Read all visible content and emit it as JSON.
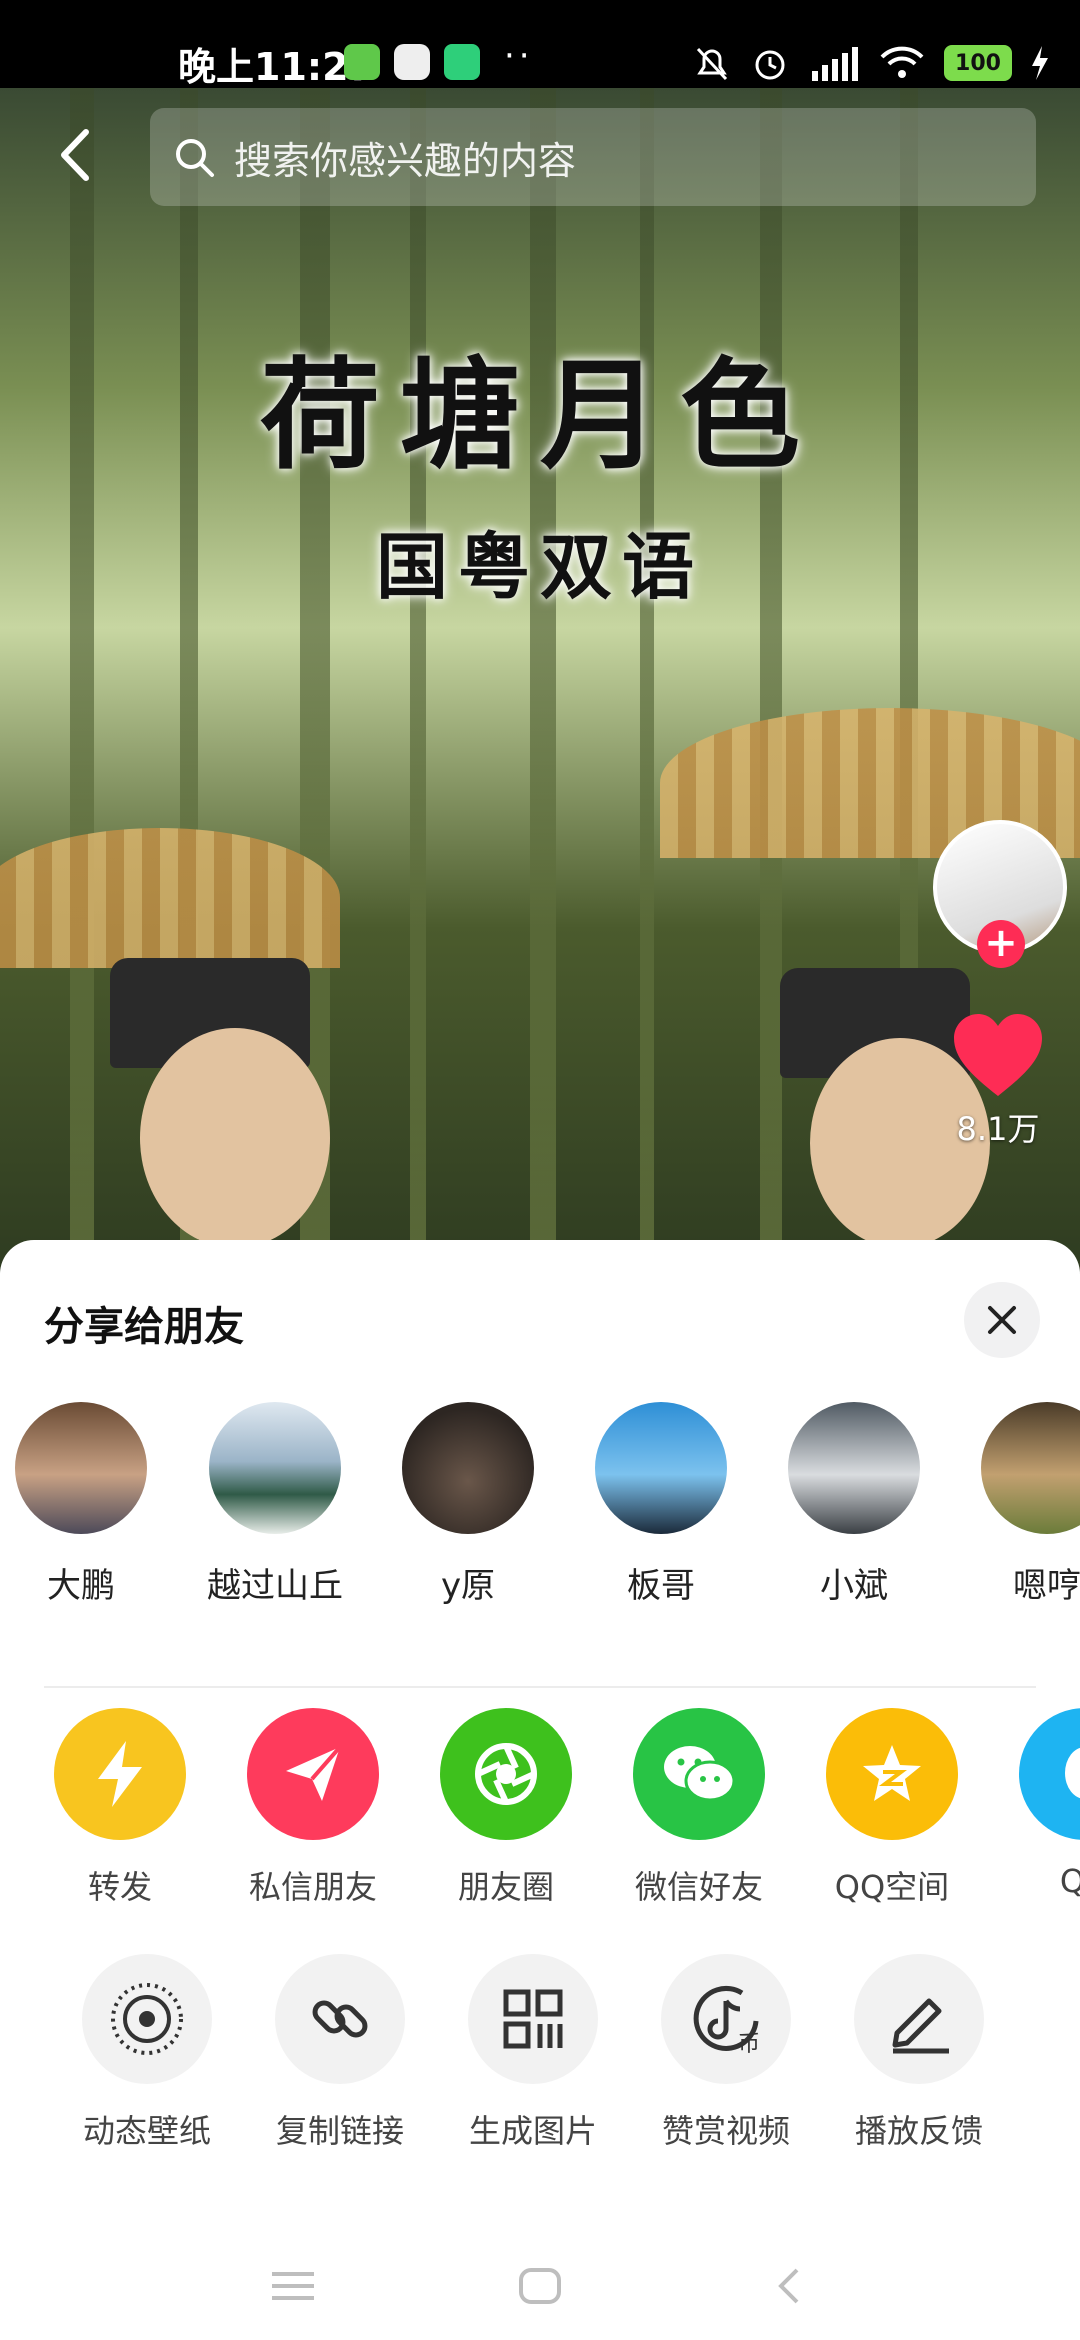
{
  "status_bar": {
    "time": "晚上11:27",
    "dots": "··",
    "battery": "100"
  },
  "search": {
    "placeholder": "搜索你感兴趣的内容"
  },
  "video": {
    "title": "荷塘月色",
    "subtitle": "国粤双语",
    "like_count": "8.1万"
  },
  "share_sheet": {
    "title": "分享给朋友",
    "friends": [
      {
        "name": "大鹏"
      },
      {
        "name": "越过山丘"
      },
      {
        "name": "y原"
      },
      {
        "name": "板哥"
      },
      {
        "name": "小斌"
      },
      {
        "name": "嗯哼"
      }
    ],
    "share_targets": [
      {
        "label": "转发",
        "color": "#f8c51f",
        "icon": "lightning-icon"
      },
      {
        "label": "私信朋友",
        "color": "#fe3b5c",
        "icon": "paper-plane-icon"
      },
      {
        "label": "朋友圈",
        "color": "#3ec11d",
        "icon": "moments-aperture-icon"
      },
      {
        "label": "微信好友",
        "color": "#28c445",
        "icon": "wechat-icon"
      },
      {
        "label": "QQ空间",
        "color": "#fbbd08",
        "icon": "qzone-star-icon"
      },
      {
        "label": "QQ",
        "color": "#1eb4f2",
        "icon": "qq-penguin-icon"
      }
    ],
    "tools": [
      {
        "label": "动态壁纸",
        "icon": "live-wallpaper-icon"
      },
      {
        "label": "复制链接",
        "icon": "link-icon"
      },
      {
        "label": "生成图片",
        "icon": "grid-image-icon"
      },
      {
        "label": "赞赏视频",
        "icon": "tip-coin-icon"
      },
      {
        "label": "播放反馈",
        "icon": "feedback-pen-icon"
      }
    ]
  }
}
